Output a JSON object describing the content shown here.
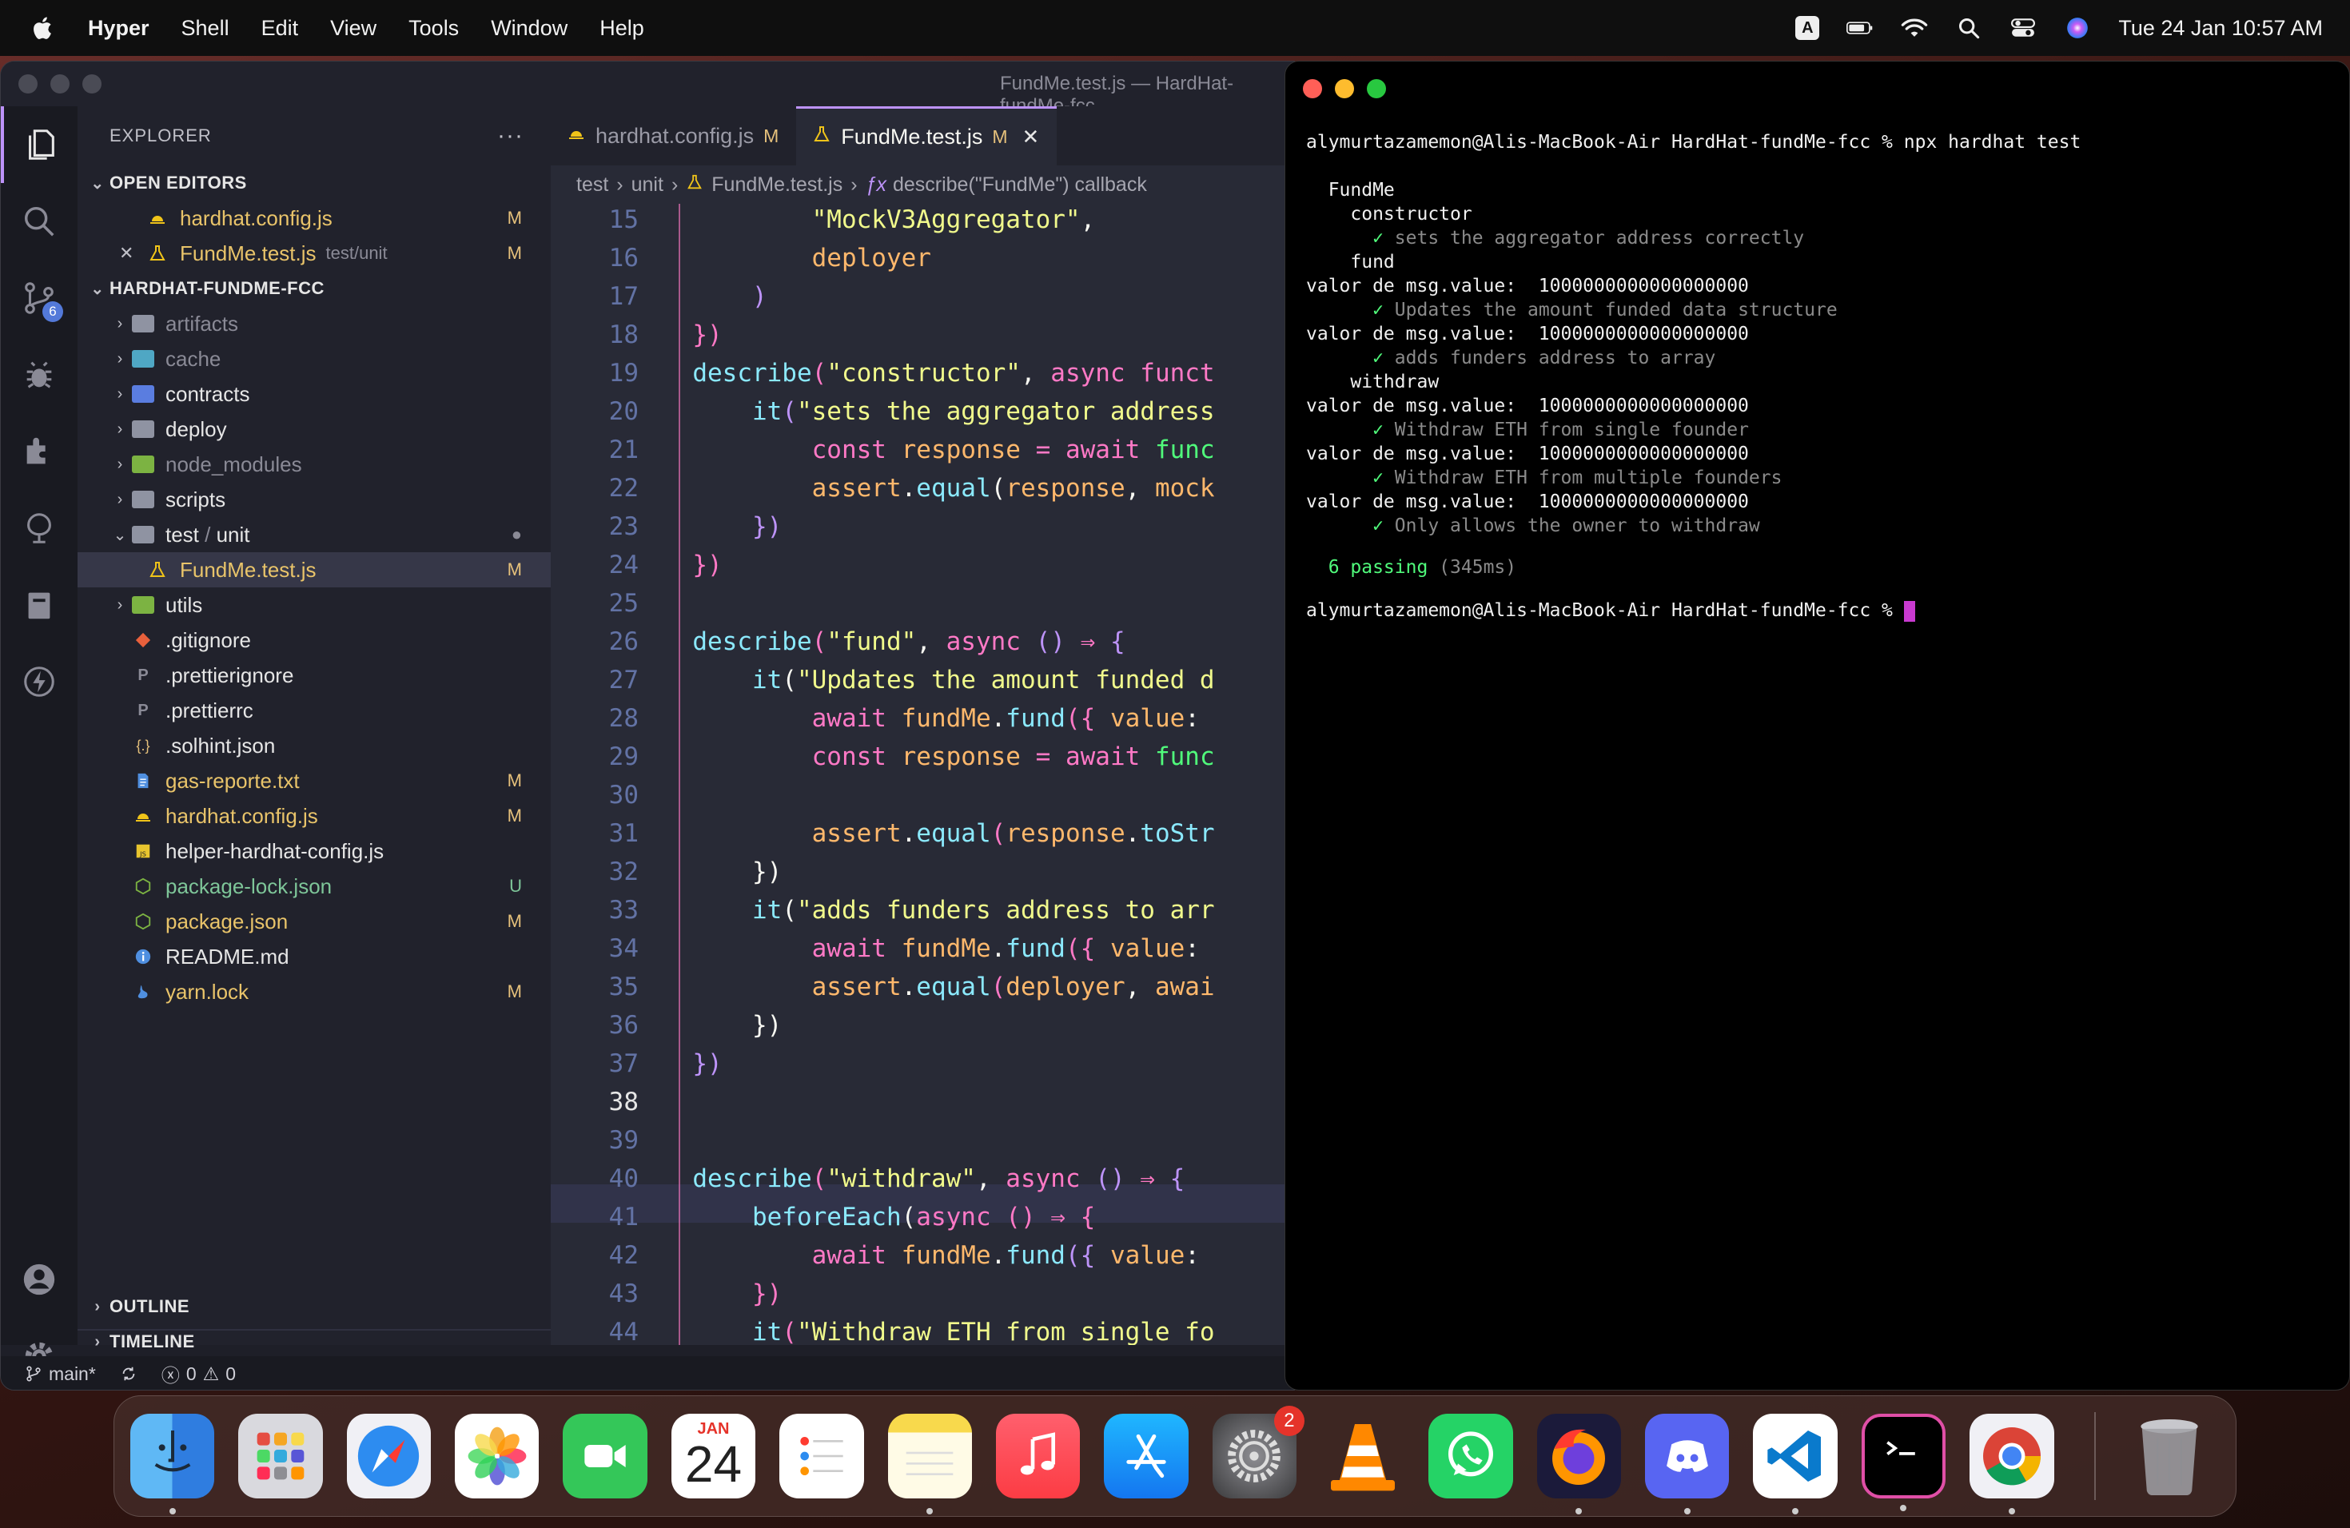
{
  "menubar": {
    "app": "Hyper",
    "items": [
      "Shell",
      "Edit",
      "View",
      "Tools",
      "Window",
      "Help"
    ],
    "input_source": "A",
    "clock": "Tue 24 Jan  10:57 AM"
  },
  "vscode": {
    "window_title": "FundMe.test.js — HardHat-fundMe-fcc",
    "scm_badge": "6",
    "explorer": {
      "title": "EXPLORER",
      "more": "···",
      "open_editors_title": "OPEN EDITORS",
      "open_editors": [
        {
          "name": "hardhat.config.js",
          "hint": "",
          "status": "M"
        },
        {
          "name": "FundMe.test.js",
          "hint": "test/unit",
          "status": "M"
        }
      ],
      "project_title": "HARDHAT-FUNDME-FCC",
      "tree": [
        {
          "name": "artifacts",
          "status": ""
        },
        {
          "name": "cache",
          "status": ""
        },
        {
          "name": "contracts",
          "status": ""
        },
        {
          "name": "deploy",
          "status": ""
        },
        {
          "name": "node_modules",
          "status": ""
        },
        {
          "name": "scripts",
          "status": ""
        },
        {
          "name": "test",
          "sub": "unit",
          "status": "●"
        },
        {
          "name": "FundMe.test.js",
          "status": "M"
        },
        {
          "name": "utils",
          "status": ""
        },
        {
          "name": ".gitignore",
          "status": ""
        },
        {
          "name": ".prettierignore",
          "status": ""
        },
        {
          "name": ".prettierrc",
          "status": ""
        },
        {
          "name": ".solhint.json",
          "status": ""
        },
        {
          "name": "gas-reporte.txt",
          "status": "M"
        },
        {
          "name": "hardhat.config.js",
          "status": "M"
        },
        {
          "name": "helper-hardhat-config.js",
          "status": ""
        },
        {
          "name": "package-lock.json",
          "status": "U"
        },
        {
          "name": "package.json",
          "status": "M"
        },
        {
          "name": "README.md",
          "status": ""
        },
        {
          "name": "yarn.lock",
          "status": "M"
        }
      ],
      "outline_title": "OUTLINE",
      "timeline_title": "TIMELINE"
    },
    "tabs": [
      {
        "label": "hardhat.config.js",
        "status": "M"
      },
      {
        "label": "FundMe.test.js",
        "status": "M",
        "close": "✕"
      }
    ],
    "breadcrumb": [
      "test",
      "unit",
      "FundMe.test.js",
      "describe(\"FundMe\") callback"
    ],
    "line_numbers": [
      "15",
      "16",
      "17",
      "18",
      "19",
      "20",
      "21",
      "22",
      "23",
      "24",
      "25",
      "26",
      "27",
      "28",
      "29",
      "30",
      "31",
      "32",
      "33",
      "34",
      "35",
      "36",
      "37",
      "38",
      "39",
      "40",
      "41",
      "42",
      "43",
      "44"
    ],
    "statusbar": {
      "branch": "main*",
      "errors": "0",
      "warnings": "0"
    }
  },
  "terminal": {
    "prompt": "alymurtazamemon@Alis-MacBook-Air HardHat-fundMe-fcc % ",
    "command": "npx hardhat test",
    "lines": [
      {
        "text": "  FundMe",
        "style": "plain"
      },
      {
        "text": "    constructor",
        "style": "plain"
      },
      {
        "text": "      ✓ sets the aggregator address correctly",
        "style": "pass"
      },
      {
        "text": "    fund",
        "style": "plain"
      },
      {
        "text": "valor de msg.value:  1000000000000000000",
        "style": "plain"
      },
      {
        "text": "      ✓ Updates the amount funded data structure",
        "style": "pass"
      },
      {
        "text": "valor de msg.value:  1000000000000000000",
        "style": "plain"
      },
      {
        "text": "      ✓ adds funders address to array",
        "style": "pass"
      },
      {
        "text": "    withdraw",
        "style": "plain"
      },
      {
        "text": "valor de msg.value:  1000000000000000000",
        "style": "plain"
      },
      {
        "text": "      ✓ Withdraw ETH from single founder",
        "style": "pass"
      },
      {
        "text": "valor de msg.value:  1000000000000000000",
        "style": "plain"
      },
      {
        "text": "      ✓ Withdraw ETH from multiple founders",
        "style": "pass"
      },
      {
        "text": "valor de msg.value:  1000000000000000000",
        "style": "plain"
      },
      {
        "text": "      ✓ Only allows the owner to withdraw",
        "style": "pass"
      }
    ],
    "passing": "  6 passing",
    "duration": " (345ms)"
  },
  "dock": {
    "calendar_month": "JAN",
    "calendar_day": "24",
    "settings_badge": "2",
    "apps": [
      "finder",
      "launchpad",
      "safari",
      "photos",
      "facetime",
      "calendar",
      "reminders",
      "notes",
      "music",
      "app-store",
      "system-settings",
      "vlc",
      "whatsapp",
      "firefox",
      "discord",
      "vscode",
      "hyper",
      "chrome",
      "trash"
    ]
  }
}
